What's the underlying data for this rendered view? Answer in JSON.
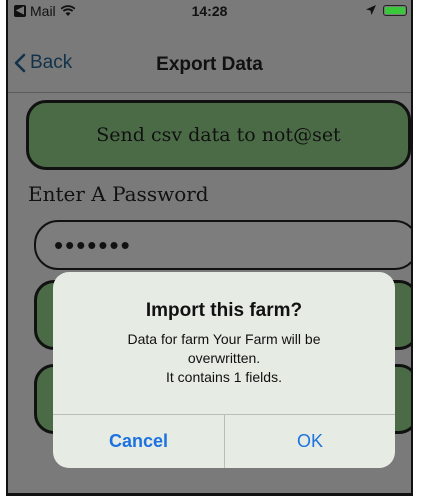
{
  "status_bar": {
    "carrier": "Mail",
    "time": "14:28"
  },
  "nav": {
    "back_label": "Back",
    "title": "Export Data"
  },
  "content": {
    "send_button_label": "Send csv data to not@set",
    "password_label": "Enter A Password",
    "password_value": "•••••••"
  },
  "alert": {
    "title": "Import this farm?",
    "message": "Data for farm Your Farm will be\noverwritten.\nIt contains 1 fields.",
    "cancel_label": "Cancel",
    "ok_label": "OK"
  },
  "colors": {
    "button_green": "#4b6b47",
    "link_blue": "#1c72e0",
    "battery_green": "#39c839"
  },
  "icons": [
    "mail-app-icon",
    "wifi-icon",
    "location-arrow-icon",
    "battery-icon",
    "chevron-left-icon"
  ]
}
